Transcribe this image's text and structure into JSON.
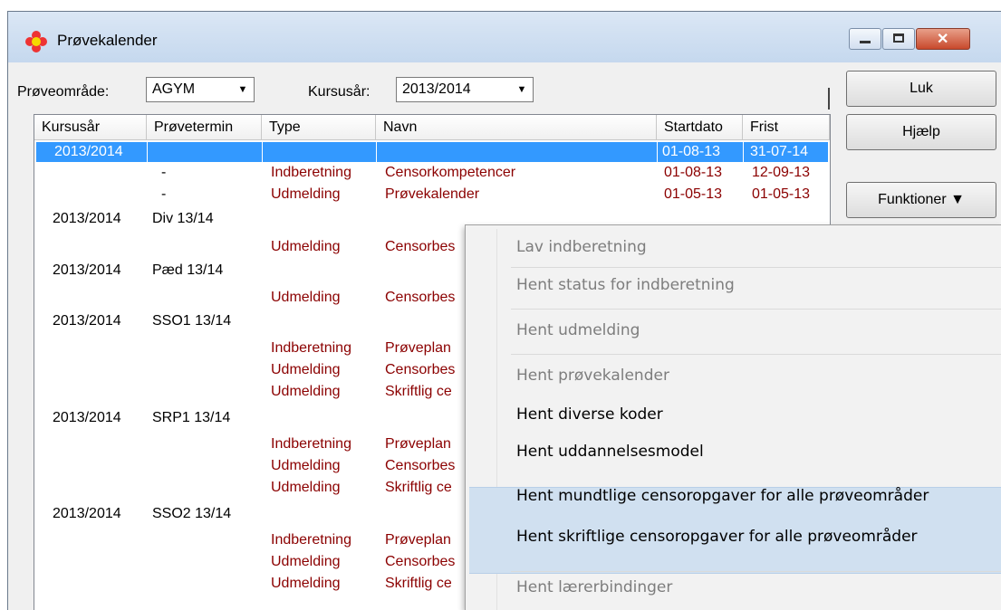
{
  "window": {
    "title": "Prøvekalender",
    "minimize_glyph": "▁",
    "maximize_glyph": "▢",
    "close_glyph": "✕"
  },
  "filters": {
    "area_label": "Prøveområde:",
    "area_value": "AGYM",
    "year_label": "Kursusår:",
    "year_value": "2013/2014"
  },
  "buttons": {
    "close": "Luk",
    "help": "Hjælp",
    "functions": "Funktioner ▼"
  },
  "grid": {
    "headers": [
      "Kursusår",
      "Prøvetermin",
      "Type",
      "Navn",
      "Startdato",
      "Frist"
    ],
    "selected_row": {
      "kursusar": "2013/2014",
      "startdato": "01-08-13",
      "frist": "31-07-14"
    },
    "rows": [
      {
        "kursusar": "",
        "termin": "-",
        "type": "Indberetning",
        "navn": "Censorkompetencer",
        "startdato": "01-08-13",
        "frist": "12-09-13"
      },
      {
        "kursusar": "",
        "termin": "-",
        "type": "Udmelding",
        "navn": "Prøvekalender",
        "startdato": "01-05-13",
        "frist": "01-05-13"
      },
      {
        "kursusar": "2013/2014",
        "termin": "Div 13/14",
        "type": "",
        "navn": "",
        "startdato": "",
        "frist": ""
      },
      {
        "kursusar": "",
        "termin": "",
        "type": "Udmelding",
        "navn": "Censorbes",
        "startdato": "",
        "frist": ""
      },
      {
        "kursusar": "2013/2014",
        "termin": "Pæd 13/14",
        "type": "",
        "navn": "",
        "startdato": "",
        "frist": ""
      },
      {
        "kursusar": "",
        "termin": "",
        "type": "Udmelding",
        "navn": "Censorbes",
        "startdato": "",
        "frist": ""
      },
      {
        "kursusar": "2013/2014",
        "termin": "SSO1 13/14",
        "type": "",
        "navn": "",
        "startdato": "",
        "frist": ""
      },
      {
        "kursusar": "",
        "termin": "",
        "type": "Indberetning",
        "navn": "Prøveplan",
        "startdato": "",
        "frist": ""
      },
      {
        "kursusar": "",
        "termin": "",
        "type": "Udmelding",
        "navn": "Censorbes",
        "startdato": "",
        "frist": ""
      },
      {
        "kursusar": "",
        "termin": "",
        "type": "Udmelding",
        "navn": "Skriftlig ce",
        "startdato": "",
        "frist": ""
      },
      {
        "kursusar": "2013/2014",
        "termin": "SRP1 13/14",
        "type": "",
        "navn": "",
        "startdato": "",
        "frist": ""
      },
      {
        "kursusar": "",
        "termin": "",
        "type": "Indberetning",
        "navn": "Prøveplan",
        "startdato": "",
        "frist": ""
      },
      {
        "kursusar": "",
        "termin": "",
        "type": "Udmelding",
        "navn": "Censorbes",
        "startdato": "",
        "frist": ""
      },
      {
        "kursusar": "",
        "termin": "",
        "type": "Udmelding",
        "navn": "Skriftlig ce",
        "startdato": "",
        "frist": ""
      },
      {
        "kursusar": "2013/2014",
        "termin": "SSO2 13/14",
        "type": "",
        "navn": "",
        "startdato": "",
        "frist": ""
      },
      {
        "kursusar": "",
        "termin": "",
        "type": "Indberetning",
        "navn": "Prøveplan",
        "startdato": "",
        "frist": ""
      },
      {
        "kursusar": "",
        "termin": "",
        "type": "Udmelding",
        "navn": "Censorbes",
        "startdato": "",
        "frist": ""
      },
      {
        "kursusar": "",
        "termin": "",
        "type": "Udmelding",
        "navn": "Skriftlig ce",
        "startdato": "",
        "frist": ""
      }
    ]
  },
  "context_menu": {
    "items": [
      {
        "label": "Lav indberetning",
        "enabled": false
      },
      {
        "label": "Hent status for indberetning",
        "enabled": false
      },
      {
        "label": "Hent udmelding",
        "enabled": false
      },
      {
        "label": "Hent prøvekalender",
        "enabled": false
      },
      {
        "label": "Hent diverse koder",
        "enabled": true
      },
      {
        "label": "Hent uddannelsesmodel",
        "enabled": true
      },
      {
        "label": "Hent mundtlige censoropgaver for alle prøveområder",
        "enabled": true,
        "highlighted": true
      },
      {
        "label": "Hent skriftlige censoropgaver for alle prøveområder",
        "enabled": true,
        "highlighted": true
      },
      {
        "label": "Hent lærerbindinger",
        "enabled": false
      }
    ]
  },
  "colors": {
    "selection": "#3399ff",
    "row_text": "#8b0000",
    "menu_highlight": "#d0e0f0"
  }
}
